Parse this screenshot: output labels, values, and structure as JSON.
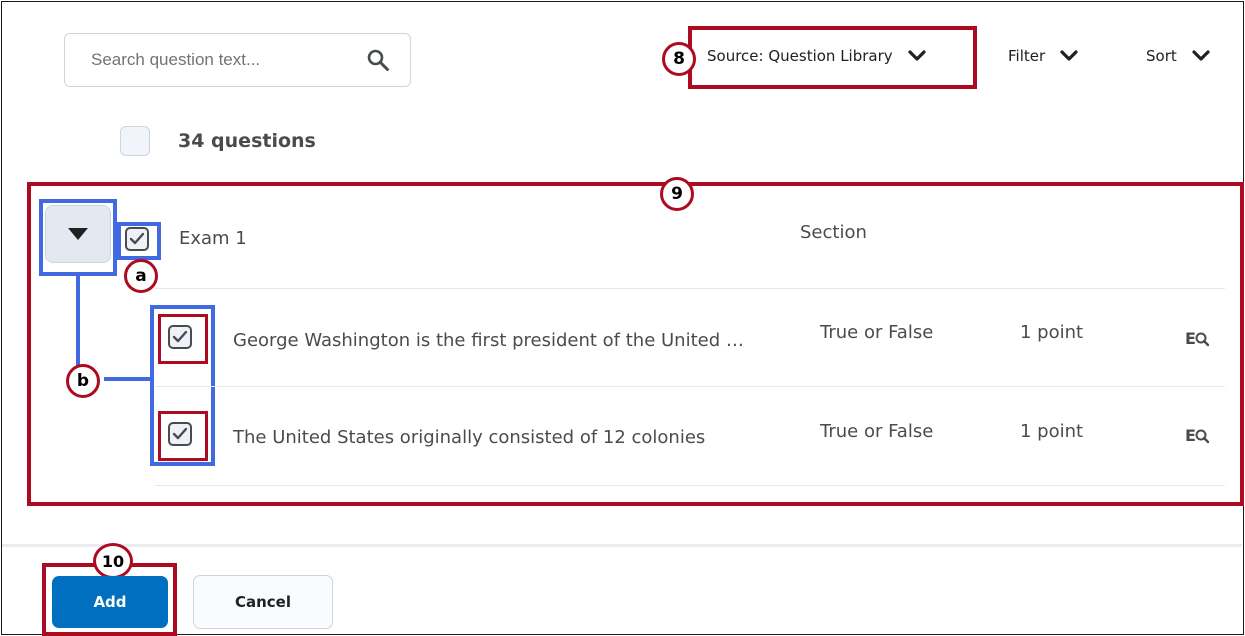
{
  "search": {
    "placeholder": "Search question text...",
    "icon": "search-icon"
  },
  "toolbar": {
    "source_label": "Source: Question Library",
    "filter_label": "Filter",
    "sort_label": "Sort",
    "chevron_icon": "chevron-down-icon"
  },
  "select_all": {
    "count_label": "34 questions"
  },
  "section": {
    "title": "Exam 1",
    "type_label": "Section",
    "questions": [
      {
        "text": "George Washington is the first president of the United …",
        "type": "True or False",
        "points": "1 point",
        "icon": "preview-icon"
      },
      {
        "text": "The United States originally consisted of 12 colonies",
        "type": "True or False",
        "points": "1 point",
        "icon": "preview-icon"
      }
    ]
  },
  "callouts": {
    "eight": "8",
    "nine": "9",
    "ten": "10",
    "a": "a",
    "b": "b"
  },
  "footer": {
    "add_label": "Add",
    "cancel_label": "Cancel"
  },
  "colors": {
    "annotation_red": "#ac0b21",
    "annotation_blue": "#4169e1",
    "primary_button": "#006fbf"
  }
}
